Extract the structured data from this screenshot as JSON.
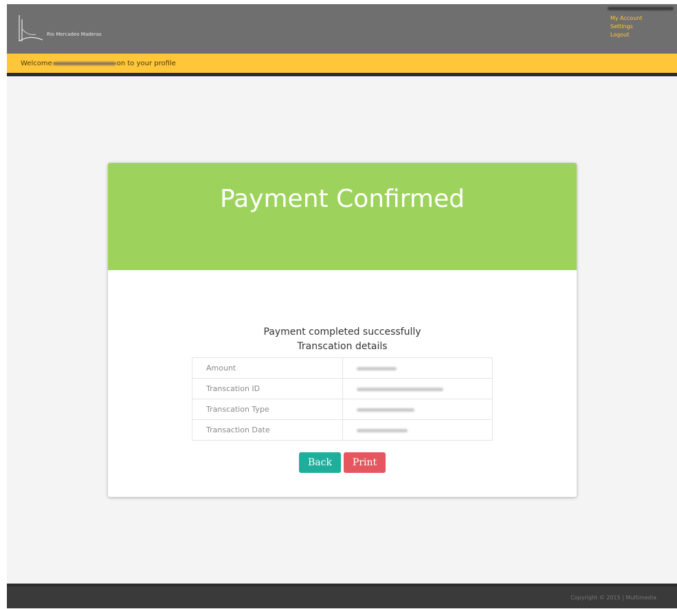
{
  "header": {
    "brand": "Rio Mercadeo Maderas",
    "menu": [
      "My Account",
      "Settings",
      "Logout"
    ]
  },
  "welcome": {
    "prefix": "Welcome",
    "suffix": "on to your profile"
  },
  "card": {
    "title": "Payment Confirmed",
    "message": "Payment completed successfully",
    "subtitle": "Transcation details",
    "rows": [
      {
        "label": "Amount"
      },
      {
        "label": "Transcation ID"
      },
      {
        "label": "Transcation Type"
      },
      {
        "label": "Transaction Date"
      }
    ],
    "back_label": "Back",
    "print_label": "Print"
  },
  "footer": {
    "copyright": "Copyright © 2015 | Multimedia"
  },
  "colors": {
    "header": "#6f6f6f",
    "accent_yellow": "#ffc63a",
    "success_green": "#9dd35d",
    "back_button": "#1fae9b",
    "print_button": "#e4575f"
  }
}
